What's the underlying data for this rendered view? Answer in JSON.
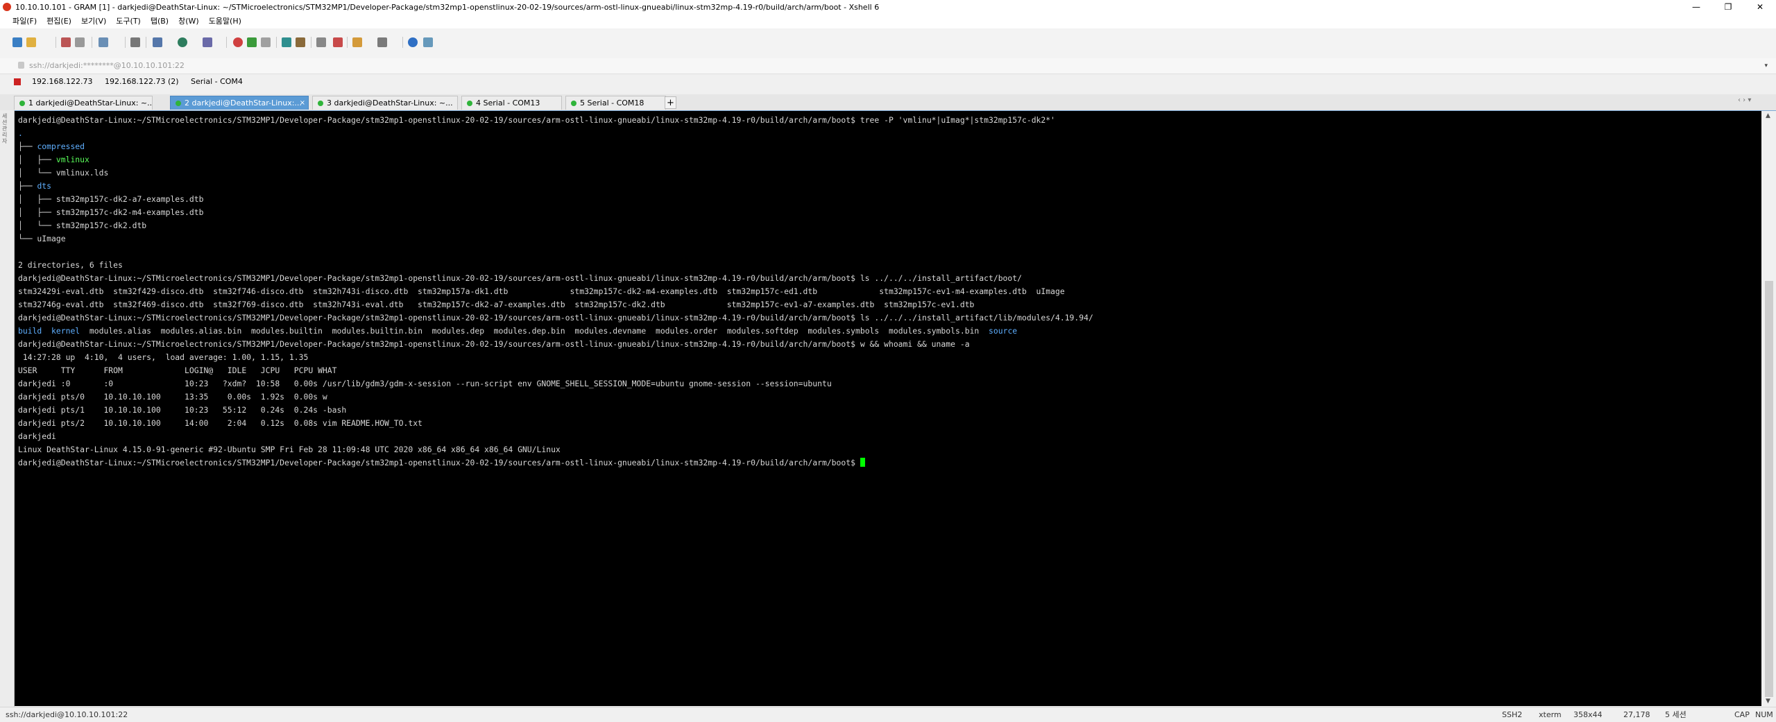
{
  "window": {
    "title": "10.10.10.101 - GRAM [1] - darkjedi@DeathStar-Linux: ~/STMicroelectronics/STM32MP1/Developer-Package/stm32mp1-openstlinux-20-02-19/sources/arm-ostl-linux-gnueabi/linux-stm32mp-4.19-r0/build/arch/arm/boot - Xshell 6",
    "minimize": "—",
    "maximize": "❐",
    "close": "✕"
  },
  "menu": [
    "파일(F)",
    "편집(E)",
    "보기(V)",
    "도구(T)",
    "탭(B)",
    "창(W)",
    "도움말(H)"
  ],
  "address": {
    "value": "ssh://darkjedi:********@10.10.10.101:22",
    "arrow": "▾"
  },
  "sessions": {
    "items": [
      "192.168.122.73",
      "192.168.122.73 (2)",
      "Serial - COM4"
    ]
  },
  "tabs": [
    {
      "label": "1 darkjedi@DeathStar-Linux: ~...",
      "active": false
    },
    {
      "label": "2 darkjedi@DeathStar-Linux:...",
      "active": true
    },
    {
      "label": "3 darkjedi@DeathStar-Linux: ~...",
      "active": false
    },
    {
      "label": "4 Serial - COM13",
      "active": false
    },
    {
      "label": "5 Serial - COM18",
      "active": false
    }
  ],
  "tab_close": "×",
  "tab_add": "+",
  "tab_nav": "‹ ›  ▾",
  "sidebar_label": "세션관리자",
  "terminal": {
    "lines": [
      [
        {
          "t": "darkjedi@DeathStar-Linux:~/STMicroelectronics/STM32MP1/Developer-Package/stm32mp1-openstlinux-20-02-19/sources/arm-ostl-linux-gnueabi/linux-stm32mp-4.19-r0/build/arch/arm/boot$ tree -P 'vmlinu*|uImag*|stm32mp157c-dk2*'",
          "c": ""
        }
      ],
      [
        {
          "t": ".",
          "c": "c-dir"
        }
      ],
      [
        {
          "t": "├── ",
          "c": ""
        },
        {
          "t": "compressed",
          "c": "c-dir"
        }
      ],
      [
        {
          "t": "│   ├── ",
          "c": ""
        },
        {
          "t": "vmlinux",
          "c": "c-exec"
        }
      ],
      [
        {
          "t": "│   └── vmlinux.lds",
          "c": ""
        }
      ],
      [
        {
          "t": "├── ",
          "c": ""
        },
        {
          "t": "dts",
          "c": "c-dir"
        }
      ],
      [
        {
          "t": "│   ├── stm32mp157c-dk2-a7-examples.dtb",
          "c": ""
        }
      ],
      [
        {
          "t": "│   ├── stm32mp157c-dk2-m4-examples.dtb",
          "c": ""
        }
      ],
      [
        {
          "t": "│   └── stm32mp157c-dk2.dtb",
          "c": ""
        }
      ],
      [
        {
          "t": "└── uImage",
          "c": ""
        }
      ],
      [
        {
          "t": "",
          "c": ""
        }
      ],
      [
        {
          "t": "2 directories, 6 files",
          "c": ""
        }
      ],
      [
        {
          "t": "darkjedi@DeathStar-Linux:~/STMicroelectronics/STM32MP1/Developer-Package/stm32mp1-openstlinux-20-02-19/sources/arm-ostl-linux-gnueabi/linux-stm32mp-4.19-r0/build/arch/arm/boot$ ls ../../../install_artifact/boot/",
          "c": ""
        }
      ],
      [
        {
          "t": "stm32429i-eval.dtb  stm32f429-disco.dtb  stm32f746-disco.dtb  stm32h743i-disco.dtb  stm32mp157a-dk1.dtb             stm32mp157c-dk2-m4-examples.dtb  stm32mp157c-ed1.dtb             stm32mp157c-ev1-m4-examples.dtb  uImage",
          "c": ""
        }
      ],
      [
        {
          "t": "stm32746g-eval.dtb  stm32f469-disco.dtb  stm32f769-disco.dtb  stm32h743i-eval.dtb   stm32mp157c-dk2-a7-examples.dtb  stm32mp157c-dk2.dtb             stm32mp157c-ev1-a7-examples.dtb  stm32mp157c-ev1.dtb",
          "c": ""
        }
      ],
      [
        {
          "t": "darkjedi@DeathStar-Linux:~/STMicroelectronics/STM32MP1/Developer-Package/stm32mp1-openstlinux-20-02-19/sources/arm-ostl-linux-gnueabi/linux-stm32mp-4.19-r0/build/arch/arm/boot$ ls ../../../install_artifact/lib/modules/4.19.94/",
          "c": ""
        }
      ],
      [
        {
          "t": "build",
          "c": "c-dir"
        },
        {
          "t": "  ",
          "c": ""
        },
        {
          "t": "kernel",
          "c": "c-dir"
        },
        {
          "t": "  modules.alias  modules.alias.bin  modules.builtin  modules.builtin.bin  modules.dep  modules.dep.bin  modules.devname  modules.order  modules.softdep  modules.symbols  modules.symbols.bin  ",
          "c": ""
        },
        {
          "t": "source",
          "c": "c-dir"
        }
      ],
      [
        {
          "t": "darkjedi@DeathStar-Linux:~/STMicroelectronics/STM32MP1/Developer-Package/stm32mp1-openstlinux-20-02-19/sources/arm-ostl-linux-gnueabi/linux-stm32mp-4.19-r0/build/arch/arm/boot$ w && whoami && uname -a",
          "c": ""
        }
      ],
      [
        {
          "t": " 14:27:28 up  4:10,  4 users,  load average: 1.00, 1.15, 1.35",
          "c": ""
        }
      ],
      [
        {
          "t": "USER     TTY      FROM             LOGIN@   IDLE   JCPU   PCPU WHAT",
          "c": ""
        }
      ],
      [
        {
          "t": "darkjedi :0       :0               10:23   ?xdm?  10:58   0.00s /usr/lib/gdm3/gdm-x-session --run-script env GNOME_SHELL_SESSION_MODE=ubuntu gnome-session --session=ubuntu",
          "c": ""
        }
      ],
      [
        {
          "t": "darkjedi pts/0    10.10.10.100     13:35    0.00s  1.92s  0.00s w",
          "c": ""
        }
      ],
      [
        {
          "t": "darkjedi pts/1    10.10.10.100     10:23   55:12   0.24s  0.24s -bash",
          "c": ""
        }
      ],
      [
        {
          "t": "darkjedi pts/2    10.10.10.100     14:00    2:04   0.12s  0.08s vim README.HOW_TO.txt",
          "c": ""
        }
      ],
      [
        {
          "t": "darkjedi",
          "c": ""
        }
      ],
      [
        {
          "t": "Linux DeathStar-Linux 4.15.0-91-generic #92-Ubuntu SMP Fri Feb 28 11:09:48 UTC 2020 x86_64 x86_64 x86_64 GNU/Linux",
          "c": ""
        }
      ],
      [
        {
          "t": "darkjedi@DeathStar-Linux:~/STMicroelectronics/STM32MP1/Developer-Package/stm32mp1-openstlinux-20-02-19/sources/arm-ostl-linux-gnueabi/linux-stm32mp-4.19-r0/build/arch/arm/boot$ ",
          "c": ""
        },
        {
          "t": "",
          "c": "cursor"
        }
      ]
    ]
  },
  "status": {
    "connection": "ssh://darkjedi@10.10.10.101:22",
    "protocol": "SSH2",
    "term": "xterm",
    "size": "358x44",
    "position": "27,178",
    "sessions": "5 세션",
    "caps": "CAP",
    "num": "NUM"
  },
  "colors": {
    "terminal_bg": "#000000",
    "terminal_fg": "#d8d8d8",
    "directory": "#5fafff",
    "executable": "#5aff5a",
    "cursor": "#00ff00",
    "active_tab": "#5b9bd5"
  }
}
